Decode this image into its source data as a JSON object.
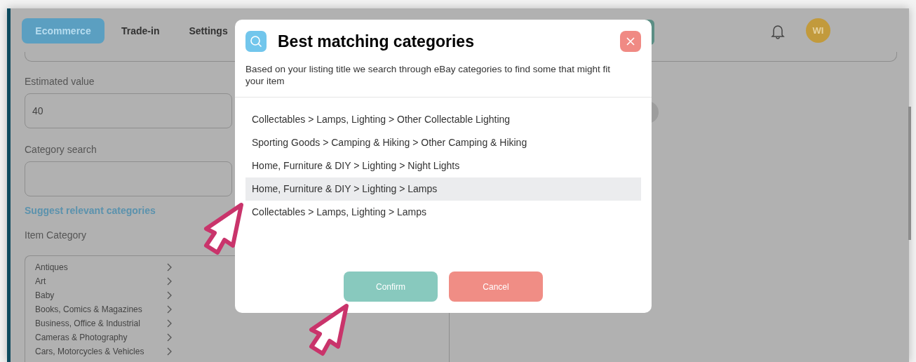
{
  "nav": {
    "tabs": [
      {
        "label": "Ecommerce",
        "selected": true
      },
      {
        "label": "Trade-in",
        "selected": false
      },
      {
        "label": "Settings",
        "selected": false
      }
    ],
    "avatar": "WI"
  },
  "form": {
    "estimated_value": {
      "label": "Estimated value",
      "value": "40"
    },
    "category_search": {
      "label": "Category search"
    },
    "suggest_link": "Suggest relevant categories",
    "item_category": {
      "label": "Item Category",
      "items": [
        "Antiques",
        "Art",
        "Baby",
        "Books, Comics & Magazines",
        "Business, Office & Industrial",
        "Cameras & Photography",
        "Cars, Motorcycles & Vehicles"
      ]
    }
  },
  "dialog": {
    "title": "Best matching categories",
    "description": "Based on your listing title we search through eBay categories to find some that might fit your item",
    "categories": [
      {
        "label": "Collectables > Lamps, Lighting > Other Collectable Lighting",
        "selected": false
      },
      {
        "label": "Sporting Goods > Camping & Hiking > Other Camping & Hiking",
        "selected": false
      },
      {
        "label": "Home, Furniture & DIY > Lighting > Night Lights",
        "selected": false
      },
      {
        "label": "Home, Furniture & DIY > Lighting > Lamps",
        "selected": true
      },
      {
        "label": "Collectables > Lamps, Lighting > Lamps",
        "selected": false
      }
    ],
    "buttons": [
      {
        "label": "Confirm",
        "kind": "confirm"
      },
      {
        "label": "Cancel",
        "kind": "cancel"
      }
    ]
  }
}
